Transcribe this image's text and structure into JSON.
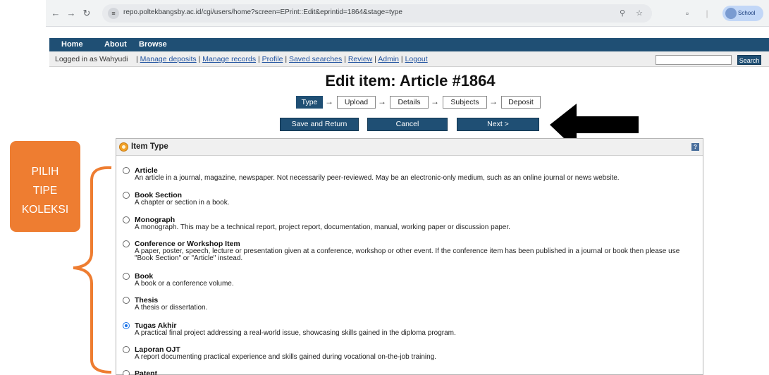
{
  "browser": {
    "url": "repo.poltekbangsby.ac.id/cgi/users/home?screen=EPrint::Edit&eprintid=1864&stage=type",
    "profile_label": "School"
  },
  "nav": {
    "main": [
      "Home",
      "About",
      "Browse"
    ],
    "logged_in": "Logged in as Wahyudi",
    "user_links": [
      "Manage deposits",
      "Manage records",
      "Profile",
      "Saved searches",
      "Review",
      "Admin",
      "Logout"
    ],
    "search_button": "Search",
    "search_placeholder": ""
  },
  "page": {
    "title": "Edit item: Article #1864",
    "stages": [
      "Type",
      "Upload",
      "Details",
      "Subjects",
      "Deposit"
    ],
    "active_stage": "Type",
    "buttons": {
      "save": "Save and Return",
      "cancel": "Cancel",
      "next": "Next >"
    }
  },
  "panel": {
    "title": "Item Type",
    "help": "?",
    "options": [
      {
        "name": "Article",
        "desc": "An article in a journal, magazine, newspaper. Not necessarily peer-reviewed. May be an electronic-only medium, such as an online journal or news website.",
        "checked": false
      },
      {
        "name": "Book Section",
        "desc": "A chapter or section in a book.",
        "checked": false
      },
      {
        "name": "Monograph",
        "desc": "A monograph. This may be a technical report, project report, documentation, manual, working paper or discussion paper.",
        "checked": false
      },
      {
        "name": "Conference or Workshop Item",
        "desc": "A paper, poster, speech, lecture or presentation given at a conference, workshop or other event. If the conference item has been published in a journal or book then please use \"Book Section\" or \"Article\" instead.",
        "checked": false
      },
      {
        "name": "Book",
        "desc": "A book or a conference volume.",
        "checked": false
      },
      {
        "name": "Thesis",
        "desc": "A thesis or dissertation.",
        "checked": false
      },
      {
        "name": "Tugas Akhir",
        "desc": "A practical final project addressing a real-world issue, showcasing skills gained in the diploma program.",
        "checked": true
      },
      {
        "name": "Laporan OJT",
        "desc": "A report documenting practical experience and skills gained during vocational on-the-job training.",
        "checked": false
      },
      {
        "name": "Patent",
        "desc": "",
        "checked": false
      }
    ]
  },
  "annotation": {
    "label_lines": [
      "PILIH",
      "TIPE",
      "KOLEKSI"
    ],
    "color": "#ee7d31"
  }
}
